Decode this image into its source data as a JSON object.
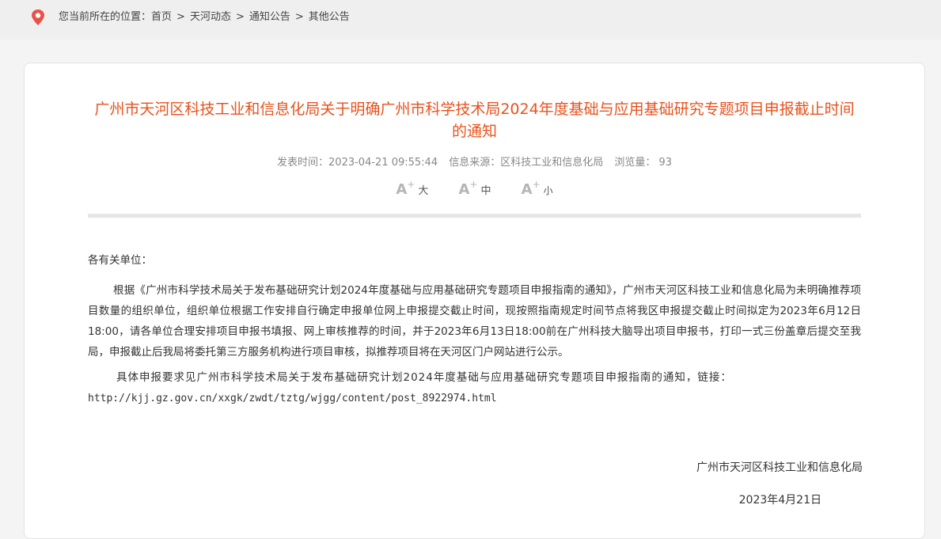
{
  "breadcrumb": {
    "prefix": "您当前所在的位置：",
    "items": [
      "首页",
      "天河动态",
      "通知公告",
      "其他公告"
    ],
    "separator": ">"
  },
  "article": {
    "title": "广州市天河区科技工业和信息化局关于明确广州市科学技术局2024年度基础与应用基础研究专题项目申报截止时间的通知",
    "meta": {
      "publish_time": "发表时间：2023-04-21 09:55:44",
      "source": "信息来源：区科技工业和信息化局",
      "views_label": "浏览量：",
      "views": "93"
    },
    "font_size": {
      "large": "大",
      "medium": "中",
      "small": "小"
    },
    "greeting": "各有关单位：",
    "paragraph1": "根据《广州市科学技术局关于发布基础研究计划2024年度基础与应用基础研究专题项目申报指南的通知》，广州市天河区科技工业和信息化局为未明确推荐项目数量的组织单位，组织单位根据工作安排自行确定申报单位网上申报提交截止时间，现按照指南规定时间节点将我区申报提交截止时间拟定为2023年6月12日18:00，请各单位合理安排项目申报书填报、网上审核推荐的时间，并于2023年6月13日18:00前在广州科技大脑导出项目申报书，打印一式三份盖章后提交至我局，申报截止后我局将委托第三方服务机构进行项目审核，拟推荐项目将在天河区门户网站进行公示。",
    "paragraph2": "具体申报要求见广州市科学技术局关于发布基础研究计划2024年度基础与应用基础研究专题项目申报指南的通知，链接：",
    "link": "http://kjj.gz.gov.cn/xxgk/zwdt/tztg/wjgg/content/post_8922974.html",
    "signature_org": "广州市天河区科技工业和信息化局",
    "signature_date": "2023年4月21日"
  },
  "colors": {
    "title": "#e8521e",
    "pin": "#e8524a",
    "divider": "#e6e6e6"
  }
}
